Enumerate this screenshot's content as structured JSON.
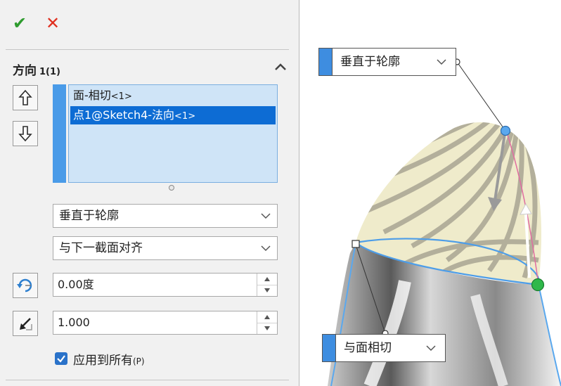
{
  "toolbar": {
    "ok_glyph": "✔",
    "cancel_glyph": "✕"
  },
  "section": {
    "title": "方向",
    "count": "1(1)"
  },
  "list": {
    "items": [
      {
        "text": "面-相切",
        "suffix": "<1>",
        "selected": false
      },
      {
        "text": "点1@Sketch4-法向",
        "suffix": "<1>",
        "selected": true
      }
    ]
  },
  "combo_profile": {
    "value": "垂直于轮廓"
  },
  "combo_align": {
    "value": "与下一截面对齐"
  },
  "angle_field": {
    "value": "0.00度"
  },
  "length_field": {
    "value": "1.000"
  },
  "apply_all": {
    "label": "应用到所有",
    "accel": "(P)",
    "checked": true
  },
  "callout_top": {
    "text": "垂直于轮廓"
  },
  "callout_bottom": {
    "text": "与面相切"
  },
  "colors": {
    "accent": "#4a9be8",
    "selection": "#0d6cd4",
    "ok": "#2e9b2e",
    "cancel": "#e03020"
  }
}
